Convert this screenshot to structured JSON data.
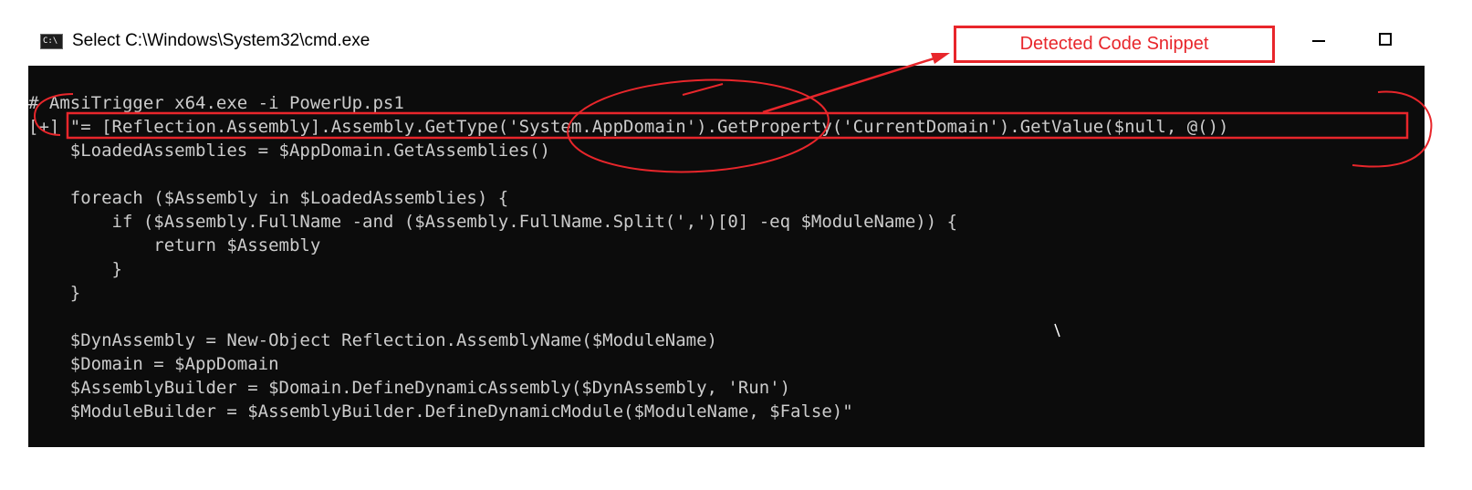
{
  "window": {
    "app_icon_text": "C:\\",
    "title": "Select C:\\Windows\\System32\\cmd.exe",
    "icons": {
      "app": "console-app-icon",
      "minimize": "minimize-icon",
      "maximize": "maximize-icon"
    }
  },
  "console": {
    "background": "#0c0c0c",
    "text_color": "#cccccc",
    "lines": [
      "# AmsiTrigger x64.exe -i PowerUp.ps1",
      "[+] \"= [Reflection.Assembly].Assembly.GetType('System.AppDomain').GetProperty('CurrentDomain').GetValue($null, @())",
      "    $LoadedAssemblies = $AppDomain.GetAssemblies()",
      "",
      "    foreach ($Assembly in $LoadedAssemblies) {",
      "        if ($Assembly.FullName -and ($Assembly.FullName.Split(',')[0] -eq $ModuleName)) {",
      "            return $Assembly",
      "        }",
      "    }",
      "",
      "    $DynAssembly = New-Object Reflection.AssemblyName($ModuleName)",
      "    $Domain = $AppDomain",
      "    $AssemblyBuilder = $Domain.DefineDynamicAssembly($DynAssembly, 'Run')",
      "    $ModuleBuilder = $AssemblyBuilder.DefineDynamicModule($ModuleName, $False)\""
    ]
  },
  "annotation": {
    "label": "Detected Code Snippet",
    "color": "#e8262b"
  }
}
